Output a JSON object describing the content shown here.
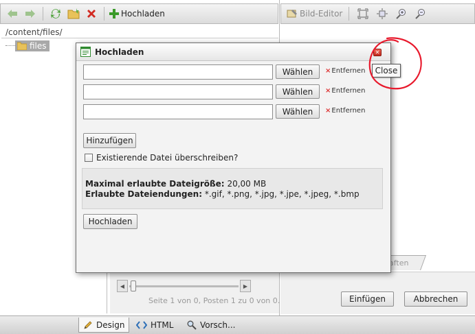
{
  "toolbar": {
    "upload_label": "Hochladen"
  },
  "editor_toolbar": {
    "image_editor_label": "Bild-Editor"
  },
  "path": "/content/files/",
  "tree": {
    "folder_label": "files"
  },
  "pager": {
    "text": "Seite 1 von 0, Posten 1 zu 0 von 0."
  },
  "right_panel": {
    "tab_label": "aften",
    "insert_label": "Einfügen",
    "cancel_label": "Abbrechen"
  },
  "bottom_tabs": [
    {
      "label": "Design",
      "icon": "pencil-icon"
    },
    {
      "label": "HTML",
      "icon": "code-icon"
    },
    {
      "label": "Vorsch...",
      "icon": "magnifier-icon"
    }
  ],
  "dialog": {
    "title": "Hochladen",
    "close_tooltip": "Close",
    "file_rows": [
      {
        "value": "",
        "browse_label": "Wählen",
        "remove_label": "Entfernen"
      },
      {
        "value": "",
        "browse_label": "Wählen",
        "remove_label": "Entfernen"
      },
      {
        "value": "",
        "browse_label": "Wählen",
        "remove_label": "Entfernen"
      }
    ],
    "add_label": "Hinzufügen",
    "overwrite_label": "Existierende Datei überschreiben?",
    "overwrite_checked": false,
    "max_size_label": "Maximal erlaubte Dateigröße:",
    "max_size_value": "20,00 MB",
    "extensions_label": "Erlaubte Dateiendungen:",
    "extensions_value": "*.gif, *.png, *.jpg, *.jpe, *.jpeg, *.bmp",
    "upload_label": "Hochladen"
  },
  "colors": {
    "annotation": "#e8192c",
    "close_button": "#d13a2c",
    "add_icon": "#3b9a2a",
    "delete_icon": "#d22a22"
  }
}
